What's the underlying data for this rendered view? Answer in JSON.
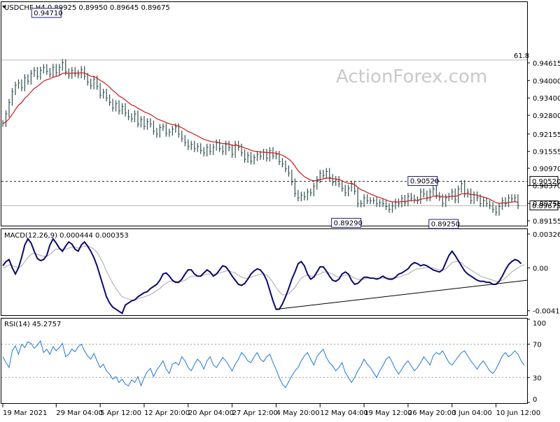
{
  "chart_data": [
    {
      "type": "line",
      "panel": "price",
      "title": "USDCHF,H4  0.89925 0.89950 0.89645 0.89675",
      "watermark": "ActionForex.com",
      "ylim": [
        0.8901,
        0.9669
      ],
      "y_ticks": [
        "0.94615",
        "0.94000",
        "0.93400",
        "0.92800",
        "0.92155",
        "0.91555",
        "0.90970",
        "0.90370",
        "0.89755",
        "0.89155"
      ],
      "y_tick_values": [
        0.94615,
        0.94,
        0.934,
        0.928,
        0.92155,
        0.91555,
        0.9097,
        0.9037,
        0.89755,
        0.89155
      ],
      "x_ticks": [
        "19 Mar 2021",
        "29 Mar 04:00",
        "5 Apr 12:00",
        "12 Apr 20:00",
        "20 Apr 04:00",
        "27 Apr 12:00",
        "4 May 20:00",
        "12 May 04:00",
        "19 May 12:00",
        "26 May 20:00",
        "3 Jun 04:00",
        "10 Jun 12:00"
      ],
      "x_tick_index": [
        0,
        17,
        31,
        45,
        59,
        73,
        87,
        101,
        115,
        129,
        143,
        157
      ],
      "grid": false,
      "horizontal_lines": [
        {
          "label": "61.8",
          "value": 0.9471,
          "color": "#000000",
          "style": "solid"
        },
        {
          "label": "0.90520",
          "value": 0.9052,
          "color": "#000000",
          "style": "dashed",
          "boxed": true
        },
        {
          "label": "0.89675",
          "value": 0.89675,
          "color": "#000000",
          "style": "solid",
          "boxed": true
        }
      ],
      "annotations": [
        {
          "text": "0.94710",
          "index": 19,
          "value": 0.9471
        },
        {
          "text": "0.89290",
          "index": 114,
          "value": 0.8929
        },
        {
          "text": "0.90520",
          "index": 137,
          "value": 0.9052
        },
        {
          "text": "0.89250",
          "index": 145,
          "value": 0.8925
        }
      ],
      "series": [
        {
          "kind": "close",
          "color": "#2f4f4f",
          "values": [
            0.9252,
            0.9285,
            0.9325,
            0.9362,
            0.9384,
            0.9392,
            0.9375,
            0.941,
            0.9398,
            0.9425,
            0.9435,
            0.9415,
            0.9436,
            0.9445,
            0.9432,
            0.9422,
            0.9446,
            0.9428,
            0.9446,
            0.9462,
            0.943,
            0.9418,
            0.9435,
            0.9425,
            0.942,
            0.9438,
            0.9415,
            0.9395,
            0.9382,
            0.9405,
            0.938,
            0.935,
            0.936,
            0.934,
            0.9325,
            0.9305,
            0.932,
            0.9295,
            0.931,
            0.9288,
            0.9275,
            0.9268,
            0.9285,
            0.925,
            0.9265,
            0.9242,
            0.9258,
            0.925,
            0.9225,
            0.9215,
            0.9238,
            0.924,
            0.9218,
            0.9222,
            0.9232,
            0.924,
            0.9215,
            0.92,
            0.9185,
            0.9172,
            0.918,
            0.9165,
            0.9172,
            0.9158,
            0.915,
            0.917,
            0.9155,
            0.917,
            0.9185,
            0.9165,
            0.9155,
            0.918,
            0.9168,
            0.9145,
            0.918,
            0.917,
            0.915,
            0.9128,
            0.9142,
            0.9122,
            0.9134,
            0.9145,
            0.9138,
            0.9152,
            0.9132,
            0.9158,
            0.914,
            0.9145,
            0.912,
            0.9112,
            0.9095,
            0.908,
            0.905,
            0.901,
            0.8995,
            0.9004,
            0.8998,
            0.9015,
            0.9012,
            0.9035,
            0.9058,
            0.908,
            0.9072,
            0.9086,
            0.9065,
            0.9048,
            0.9058,
            0.9043,
            0.9028,
            0.9012,
            0.9028,
            0.9042,
            0.9018,
            0.8974,
            0.8975,
            0.8995,
            0.8985,
            0.8985,
            0.8985,
            0.8975,
            0.8978,
            0.8975,
            0.8965,
            0.8955,
            0.8967,
            0.898,
            0.8974,
            0.8993,
            0.8978,
            0.9,
            0.8994,
            0.8988,
            0.8985,
            0.9015,
            0.9008,
            0.8995,
            0.9015,
            0.9025,
            0.9003,
            0.8996,
            0.8975,
            0.8995,
            0.9,
            0.9015,
            0.8988,
            0.9025,
            0.9044,
            0.9008,
            0.9015,
            0.8985,
            0.9005,
            0.8995,
            0.8975,
            0.8985,
            0.8975,
            0.8968,
            0.8955,
            0.8945,
            0.8965,
            0.8985,
            0.8975,
            0.8995,
            0.8992,
            0.8995,
            0.8968
          ]
        },
        {
          "kind": "moving-average",
          "color": "#d11818",
          "values": [
            0.9252,
            0.9257,
            0.9268,
            0.9283,
            0.93,
            0.9315,
            0.9324,
            0.9339,
            0.9349,
            0.9361,
            0.9373,
            0.938,
            0.9389,
            0.9398,
            0.9403,
            0.9406,
            0.9412,
            0.9414,
            0.9418,
            0.9425,
            0.9426,
            0.9425,
            0.9426,
            0.9426,
            0.9426,
            0.9427,
            0.9426,
            0.9421,
            0.9415,
            0.9414,
            0.9409,
            0.9401,
            0.9395,
            0.9387,
            0.9377,
            0.9366,
            0.9358,
            0.9347,
            0.9341,
            0.9333,
            0.9324,
            0.9316,
            0.9312,
            0.9304,
            0.9299,
            0.9292,
            0.9288,
            0.9283,
            0.9276,
            0.9268,
            0.9264,
            0.926,
            0.9255,
            0.9251,
            0.9248,
            0.9246,
            0.9242,
            0.9237,
            0.9231,
            0.9224,
            0.922,
            0.9214,
            0.9209,
            0.9203,
            0.9197,
            0.9194,
            0.919,
            0.9188,
            0.9188,
            0.9185,
            0.9182,
            0.9182,
            0.9181,
            0.9176,
            0.9176,
            0.9175,
            0.9172,
            0.9167,
            0.9164,
            0.9159,
            0.9156,
            0.9155,
            0.9153,
            0.9153,
            0.9151,
            0.9151,
            0.915,
            0.9149,
            0.9146,
            0.9142,
            0.9136,
            0.9129,
            0.9119,
            0.9104,
            0.9089,
            0.9078,
            0.9068,
            0.9062,
            0.9056,
            0.9054,
            0.9054,
            0.9058,
            0.906,
            0.9063,
            0.9063,
            0.9061,
            0.906,
            0.9058,
            0.9054,
            0.9048,
            0.9045,
            0.9045,
            0.9041,
            0.9031,
            0.9023,
            0.9019,
            0.9013,
            0.9008,
            0.9004,
            0.8999,
            0.8996,
            0.8992,
            0.8988,
            0.8983,
            0.8981,
            0.8981,
            0.898,
            0.8982,
            0.8982,
            0.8984,
            0.8986,
            0.8986,
            0.8986,
            0.899,
            0.8992,
            0.8993,
            0.8996,
            0.9,
            0.9001,
            0.9001,
            0.8998,
            0.8998,
            0.8998,
            0.9001,
            0.9,
            0.9003,
            0.9009,
            0.9009,
            0.901,
            0.9006,
            0.9006,
            0.9004,
            0.9,
            0.8998,
            0.8994,
            0.899,
            0.8984,
            0.8978,
            0.8976,
            0.8977,
            0.8977,
            0.8979,
            0.898,
            0.8982,
            0.8979
          ]
        }
      ]
    },
    {
      "type": "line",
      "panel": "macd",
      "title": "MACD(12,26,9) 0.000444 0.000353",
      "ylim": [
        -0.0045,
        0.0036
      ],
      "y_ticks": [
        "0.003268",
        "0.00",
        "-0.004144"
      ],
      "y_tick_values": [
        0.003268,
        0.0,
        -0.004144
      ],
      "trendline": {
        "from_index": 87,
        "from_value": -0.004,
        "to_index": 166,
        "to_value": -0.0012
      },
      "series": [
        {
          "kind": "macd",
          "color": "#0a0a6e",
          "values": [
            0.0002,
            0.0006,
            0.0008,
            0.0,
            -0.0006,
            0.0,
            0.001,
            0.0022,
            0.0028,
            0.0024,
            0.0016,
            0.0009,
            0.0007,
            0.0008,
            0.0012,
            0.0022,
            0.0028,
            0.0024,
            0.0019,
            0.0016,
            0.0021,
            0.0025,
            0.0023,
            0.0018,
            0.0016,
            0.0022,
            0.0025,
            0.0021,
            0.0016,
            0.001,
            0.0002,
            -0.0008,
            -0.0018,
            -0.0028,
            -0.0034,
            -0.0038,
            -0.004,
            -0.0042,
            -0.0044,
            -0.0036,
            -0.0034,
            -0.0032,
            -0.0031,
            -0.0028,
            -0.0026,
            -0.0024,
            -0.0023,
            -0.002,
            -0.0018,
            -0.0016,
            -0.0012,
            -0.0006,
            -0.0005,
            -0.0008,
            -0.0012,
            -0.0014,
            -0.0014,
            -0.0011,
            -0.0006,
            -0.0002,
            -0.0002,
            -0.0006,
            -0.0008,
            -0.0008,
            -0.0005,
            -0.0002,
            -0.0004,
            -0.0008,
            -0.0006,
            -0.0002,
            0.0002,
            0.0001,
            -0.0003,
            -0.0008,
            -0.0012,
            -0.0016,
            -0.0017,
            -0.0015,
            -0.0011,
            -0.0006,
            -0.0003,
            -0.0001,
            -0.0002,
            -0.0006,
            -0.0012,
            -0.0022,
            -0.0032,
            -0.004,
            -0.004,
            -0.0035,
            -0.0028,
            -0.002,
            -0.0011,
            -0.0004,
            0.0004,
            0.0006,
            0.0002,
            -0.0006,
            -0.0011,
            -0.0009,
            -0.0004,
            0.0001,
            0.0001,
            -0.0003,
            -0.0008,
            -0.0012,
            -0.0013,
            -0.0011,
            -0.0006,
            -0.0004,
            -0.0006,
            -0.0012,
            -0.0016,
            -0.0015,
            -0.0012,
            -0.0009,
            -0.0009,
            -0.001,
            -0.001,
            -0.0011,
            -0.001,
            -0.0008,
            -0.001,
            -0.0011,
            -0.0011,
            -0.0009,
            -0.0006,
            -0.0005,
            -0.0003,
            -0.0001,
            0.0003,
            0.0005,
            0.0004,
            0.0002,
            0.0003,
            0.0002,
            0.0,
            -0.0002,
            -0.0003,
            -0.0004,
            -0.0002,
            0.0005,
            0.0012,
            0.0016,
            0.0012,
            0.0007,
            0.0002,
            -0.0003,
            -0.0006,
            -0.0008,
            -0.001,
            -0.0012,
            -0.0013,
            -0.0013,
            -0.0014,
            -0.0014,
            -0.0016,
            -0.0016,
            -0.0013,
            -0.0008,
            -0.0002,
            0.0003,
            0.0006,
            0.0008,
            0.0007,
            0.0004
          ]
        },
        {
          "kind": "signal",
          "color": "#a8a8a8",
          "values": [
            0.0,
            0.0001,
            0.0003,
            0.0002,
            0.0001,
            0.0,
            0.0002,
            0.0006,
            0.001,
            0.0013,
            0.0014,
            0.0013,
            0.0012,
            0.0011,
            0.0011,
            0.0013,
            0.0016,
            0.0018,
            0.0018,
            0.0018,
            0.0018,
            0.0019,
            0.002,
            0.002,
            0.0019,
            0.002,
            0.0021,
            0.0021,
            0.002,
            0.0018,
            0.0015,
            0.001,
            0.0004,
            -0.0003,
            -0.0009,
            -0.0015,
            -0.002,
            -0.0024,
            -0.0028,
            -0.0029,
            -0.003,
            -0.0031,
            -0.0031,
            -0.003,
            -0.0029,
            -0.0028,
            -0.0027,
            -0.0026,
            -0.0024,
            -0.0022,
            -0.002,
            -0.0017,
            -0.0015,
            -0.0013,
            -0.0013,
            -0.0013,
            -0.0013,
            -0.0013,
            -0.0012,
            -0.001,
            -0.0008,
            -0.0008,
            -0.0008,
            -0.0008,
            -0.0007,
            -0.0006,
            -0.0006,
            -0.0006,
            -0.0006,
            -0.0005,
            -0.0004,
            -0.0003,
            -0.0003,
            -0.0004,
            -0.0005,
            -0.0007,
            -0.0009,
            -0.001,
            -0.001,
            -0.0009,
            -0.0008,
            -0.0007,
            -0.0006,
            -0.0006,
            -0.0007,
            -0.001,
            -0.0014,
            -0.0019,
            -0.0023,
            -0.0026,
            -0.0026,
            -0.0025,
            -0.0022,
            -0.0019,
            -0.0014,
            -0.001,
            -0.0008,
            -0.0007,
            -0.0008,
            -0.0008,
            -0.0007,
            -0.0006,
            -0.0004,
            -0.0004,
            -0.0005,
            -0.0006,
            -0.0008,
            -0.0009,
            -0.0008,
            -0.0007,
            -0.0007,
            -0.0008,
            -0.001,
            -0.0011,
            -0.0011,
            -0.0011,
            -0.001,
            -0.001,
            -0.001,
            -0.001,
            -0.001,
            -0.001,
            -0.001,
            -0.001,
            -0.001,
            -0.001,
            -0.0009,
            -0.0008,
            -0.0007,
            -0.0006,
            -0.0004,
            -0.0002,
            -0.0001,
            -0.0001,
            0.0,
            0.0,
            0.0,
            0.0,
            -0.0001,
            -0.0002,
            -0.0002,
            -0.0001,
            0.0002,
            0.0005,
            0.0006,
            0.0006,
            0.0005,
            0.0002,
            0.0,
            -0.0002,
            -0.0004,
            -0.0006,
            -0.0008,
            -0.0009,
            -0.001,
            -0.0011,
            -0.0012,
            -0.0013,
            -0.0013,
            -0.0012,
            -0.001,
            -0.0007,
            -0.0004,
            -0.0002,
            0.0,
            0.0002,
            0.0003
          ]
        }
      ]
    },
    {
      "type": "line",
      "panel": "rsi",
      "title": "RSI(14) 45.2757",
      "ylim": [
        0,
        100
      ],
      "y_ticks": [
        "100",
        "70",
        "30",
        "0"
      ],
      "y_tick_values": [
        100,
        70,
        30,
        0
      ],
      "levels": [
        70,
        30
      ],
      "series": [
        {
          "kind": "rsi",
          "color": "#1e78dc",
          "values": [
            55,
            48,
            42,
            62,
            68,
            58,
            70,
            66,
            73,
            71,
            65,
            69,
            74,
            60,
            64,
            58,
            67,
            62,
            66,
            71,
            55,
            58,
            64,
            61,
            67,
            70,
            62,
            56,
            52,
            59,
            50,
            42,
            46,
            38,
            34,
            28,
            31,
            24,
            28,
            22,
            20,
            27,
            24,
            31,
            20,
            30,
            37,
            41,
            31,
            39,
            44,
            50,
            40,
            35,
            46,
            48,
            45,
            55,
            50,
            42,
            38,
            46,
            52,
            48,
            40,
            50,
            55,
            45,
            42,
            48,
            54,
            50,
            44,
            38,
            46,
            52,
            60,
            56,
            50,
            48,
            55,
            60,
            52,
            49,
            55,
            58,
            48,
            40,
            30,
            22,
            18,
            25,
            32,
            38,
            42,
            50,
            56,
            60,
            52,
            45,
            55,
            60,
            64,
            54,
            48,
            44,
            38,
            42,
            48,
            36,
            30,
            24,
            30,
            38,
            44,
            52,
            46,
            42,
            36,
            30,
            38,
            44,
            52,
            55,
            48,
            40,
            34,
            40,
            46,
            50,
            44,
            38,
            42,
            48,
            55,
            50,
            45,
            56,
            60,
            58,
            62,
            55,
            48,
            45,
            50,
            55,
            60,
            62,
            56,
            50,
            45,
            40,
            46,
            50,
            44,
            38,
            35,
            40,
            48,
            56,
            60,
            55,
            58,
            62,
            58,
            50,
            45
          ]
        }
      ]
    }
  ]
}
